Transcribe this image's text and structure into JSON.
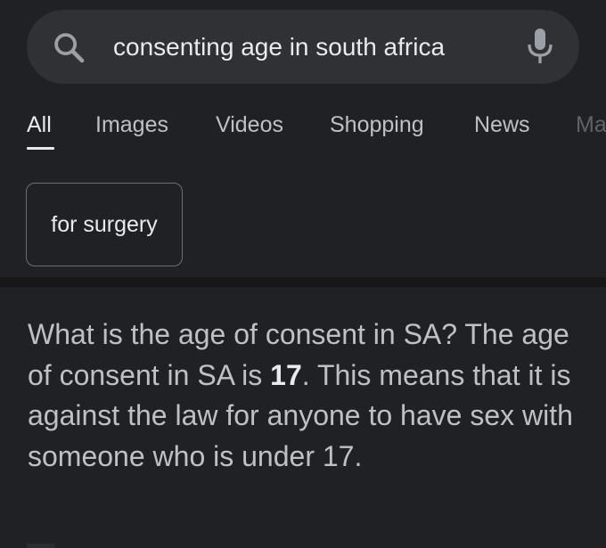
{
  "search": {
    "query": "consenting age in south africa",
    "icon": "search-icon",
    "mic_icon": "microphone-icon"
  },
  "tabs": [
    {
      "label": "All",
      "active": true
    },
    {
      "label": "Images",
      "active": false
    },
    {
      "label": "Videos",
      "active": false
    },
    {
      "label": "Shopping",
      "active": false
    },
    {
      "label": "News",
      "active": false
    },
    {
      "label": "Ma",
      "active": false
    }
  ],
  "chip": {
    "label": "for surgery"
  },
  "snippet": {
    "text_before": "What is the age of consent in SA? The age of consent in SA is ",
    "highlight": "17",
    "text_after": ". This means that it is against the law for anyone to have sex with someone who is under 17."
  },
  "colors": {
    "background": "#202124",
    "search_bar": "#303134",
    "text_primary": "#e8eaed",
    "text_secondary": "#bdc1c6"
  }
}
